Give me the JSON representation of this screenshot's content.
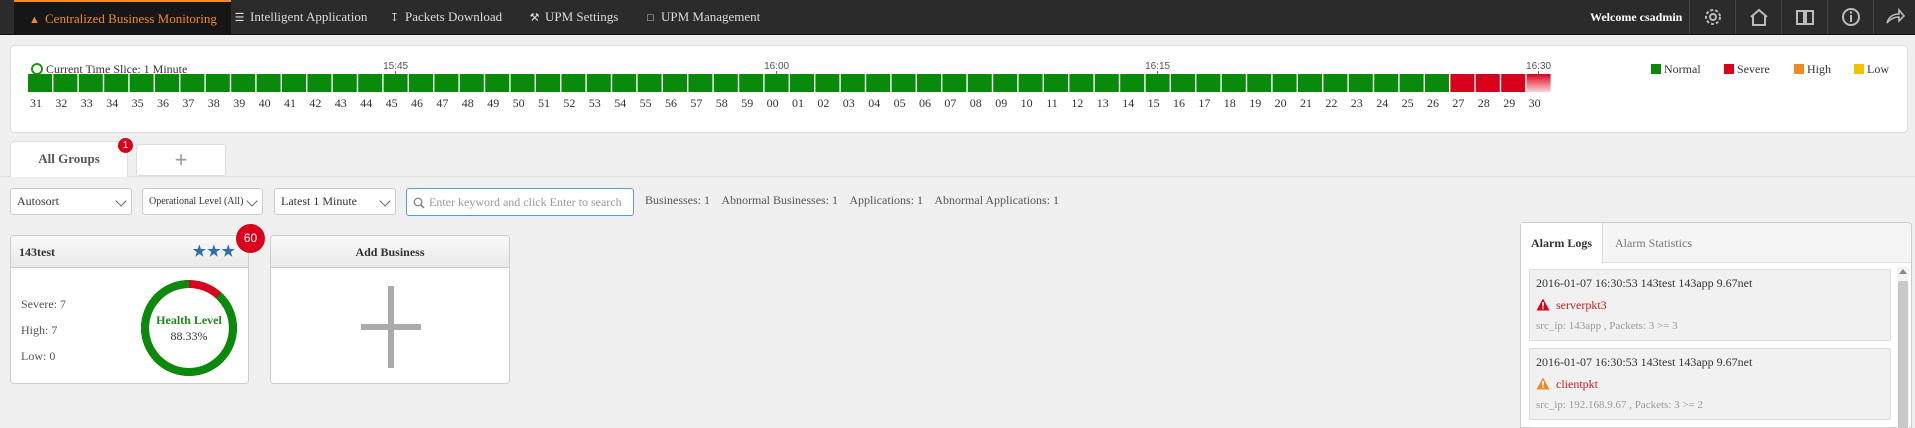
{
  "nav": {
    "items": [
      {
        "label": "Centralized Business Monitoring",
        "icon": "sitemap-icon",
        "active": true
      },
      {
        "label": "Intelligent Application",
        "icon": "list-icon",
        "active": false
      },
      {
        "label": "Packets Download",
        "icon": "download-icon",
        "active": false
      },
      {
        "label": "UPM Settings",
        "icon": "wrench-icon",
        "active": false
      },
      {
        "label": "UPM Management",
        "icon": "laptop-icon",
        "active": false
      }
    ],
    "welcome": "Welcome csadmin",
    "tools": [
      "gear-icon",
      "home-icon",
      "book-icon",
      "info-icon",
      "share-icon"
    ]
  },
  "timeline": {
    "current_slice": "Current Time Slice: 1 Minute",
    "legend": [
      {
        "label": "Normal",
        "color": "#0a8a0a"
      },
      {
        "label": "Severe",
        "color": "#d9001b"
      },
      {
        "label": "High",
        "color": "#f08a24"
      },
      {
        "label": "Low",
        "color": "#f2c200"
      }
    ],
    "time_markers": [
      {
        "label": "15:45",
        "at": "45"
      },
      {
        "label": "16:00",
        "at": "00"
      },
      {
        "label": "16:15",
        "at": "15"
      },
      {
        "label": "16:30",
        "at": "30"
      }
    ],
    "slots": [
      {
        "label": "31",
        "status": "normal"
      },
      {
        "label": "32",
        "status": "normal"
      },
      {
        "label": "33",
        "status": "normal"
      },
      {
        "label": "34",
        "status": "normal"
      },
      {
        "label": "35",
        "status": "normal"
      },
      {
        "label": "36",
        "status": "normal"
      },
      {
        "label": "37",
        "status": "normal"
      },
      {
        "label": "38",
        "status": "normal"
      },
      {
        "label": "39",
        "status": "normal"
      },
      {
        "label": "40",
        "status": "normal"
      },
      {
        "label": "41",
        "status": "normal"
      },
      {
        "label": "42",
        "status": "normal"
      },
      {
        "label": "43",
        "status": "normal"
      },
      {
        "label": "44",
        "status": "normal"
      },
      {
        "label": "45",
        "status": "normal"
      },
      {
        "label": "46",
        "status": "normal"
      },
      {
        "label": "47",
        "status": "normal"
      },
      {
        "label": "48",
        "status": "normal"
      },
      {
        "label": "49",
        "status": "normal"
      },
      {
        "label": "50",
        "status": "normal"
      },
      {
        "label": "51",
        "status": "normal"
      },
      {
        "label": "52",
        "status": "normal"
      },
      {
        "label": "53",
        "status": "normal"
      },
      {
        "label": "54",
        "status": "normal"
      },
      {
        "label": "55",
        "status": "normal"
      },
      {
        "label": "56",
        "status": "normal"
      },
      {
        "label": "57",
        "status": "normal"
      },
      {
        "label": "58",
        "status": "normal"
      },
      {
        "label": "59",
        "status": "normal"
      },
      {
        "label": "00",
        "status": "normal"
      },
      {
        "label": "01",
        "status": "normal"
      },
      {
        "label": "02",
        "status": "normal"
      },
      {
        "label": "03",
        "status": "normal"
      },
      {
        "label": "04",
        "status": "normal"
      },
      {
        "label": "05",
        "status": "normal"
      },
      {
        "label": "06",
        "status": "normal"
      },
      {
        "label": "07",
        "status": "normal"
      },
      {
        "label": "08",
        "status": "normal"
      },
      {
        "label": "09",
        "status": "normal"
      },
      {
        "label": "10",
        "status": "normal"
      },
      {
        "label": "11",
        "status": "normal"
      },
      {
        "label": "12",
        "status": "normal"
      },
      {
        "label": "13",
        "status": "normal"
      },
      {
        "label": "14",
        "status": "normal"
      },
      {
        "label": "15",
        "status": "normal"
      },
      {
        "label": "16",
        "status": "normal"
      },
      {
        "label": "17",
        "status": "normal"
      },
      {
        "label": "18",
        "status": "normal"
      },
      {
        "label": "19",
        "status": "normal"
      },
      {
        "label": "20",
        "status": "normal"
      },
      {
        "label": "21",
        "status": "normal"
      },
      {
        "label": "22",
        "status": "normal"
      },
      {
        "label": "23",
        "status": "normal"
      },
      {
        "label": "24",
        "status": "normal"
      },
      {
        "label": "25",
        "status": "normal"
      },
      {
        "label": "26",
        "status": "normal"
      },
      {
        "label": "27",
        "status": "severe"
      },
      {
        "label": "28",
        "status": "severe"
      },
      {
        "label": "29",
        "status": "severe"
      },
      {
        "label": "30",
        "status": "severe-current"
      }
    ]
  },
  "groups": {
    "tab_label": "All Groups",
    "tab_badge": "1",
    "add_tab": "+"
  },
  "filters": {
    "sort": "Autosort",
    "level": "Operational Level (All)",
    "range": "Latest 1 Minute",
    "search_placeholder": "Enter keyword and click Enter to search",
    "stats": [
      "Businesses: 1",
      "Abnormal Businesses: 1",
      "Applications: 1",
      "Abnormal Applications: 1"
    ]
  },
  "business_card": {
    "name": "143test",
    "stars": "★★★",
    "badge": "60",
    "severe": "Severe: 7",
    "high": "High: 7",
    "low": "Low: 0",
    "health_label": "Health Level",
    "health_value": "88.33%",
    "health_fraction": 0.8833,
    "health_color": "#0a8a0a",
    "problem_color": "#d9001b"
  },
  "add_business": {
    "title": "Add Business"
  },
  "alarm_panel": {
    "tabs": [
      "Alarm Logs",
      "Alarm Statistics"
    ],
    "entries": [
      {
        "header": "2016-01-07 16:30:53 143test 143app 9.67net",
        "name": "serverpkt3",
        "detail": "src_ip: 143app , Packets: 3 >= 3",
        "severity": "severe",
        "icon_color": "#d9001b"
      },
      {
        "header": "2016-01-07 16:30:53 143test 143app 9.67net",
        "name": "clientpkt",
        "detail": "src_ip: 192.168.9.67 , Packets: 3 >= 2",
        "severity": "high",
        "icon_color": "#f08a24"
      }
    ]
  }
}
